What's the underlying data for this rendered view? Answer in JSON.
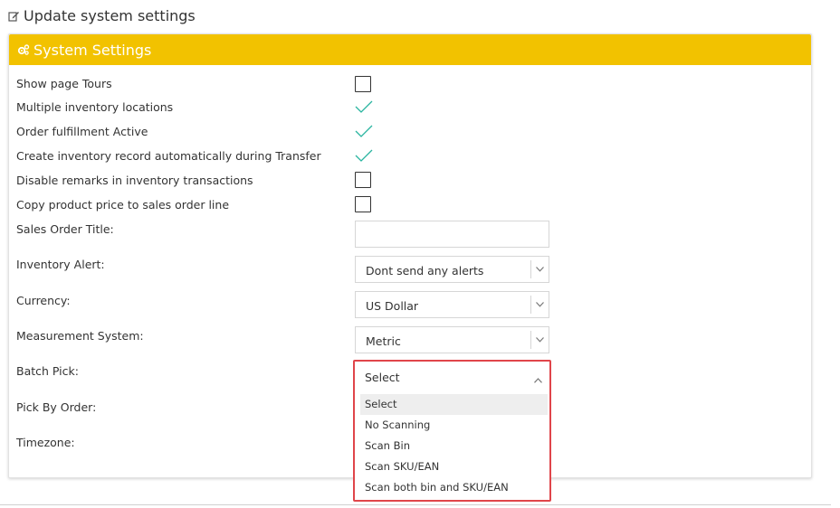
{
  "page": {
    "title": "Update system settings",
    "title_icon": "edit-icon"
  },
  "panel": {
    "title": "System Settings",
    "icon": "cogs-icon",
    "header_color": "#f2c200"
  },
  "checkbox_rows": [
    {
      "label": "Show page Tours",
      "checked": false
    },
    {
      "label": "Multiple inventory locations",
      "checked": true
    },
    {
      "label": "Order fulfillment Active",
      "checked": true
    },
    {
      "label": "Create inventory record automatically during Transfer",
      "checked": true
    },
    {
      "label": "Disable remarks in inventory transactions",
      "checked": false
    },
    {
      "label": "Copy product price to sales order line",
      "checked": false
    }
  ],
  "fields": {
    "sales_order_title": {
      "label": "Sales Order Title:",
      "value": ""
    },
    "inventory_alert": {
      "label": "Inventory Alert:",
      "value": "Dont send any alerts"
    },
    "currency": {
      "label": "Currency:",
      "value": "US Dollar"
    },
    "measurement_system": {
      "label": "Measurement System:",
      "value": "Metric"
    },
    "batch_pick": {
      "label": "Batch Pick:",
      "value": "Select",
      "options": [
        "Select",
        "No Scanning",
        "Scan Bin",
        "Scan SKU/EAN",
        "Scan both bin and SKU/EAN"
      ],
      "highlighted_option": "Select"
    },
    "pick_by_order": {
      "label": "Pick By Order:"
    },
    "timezone": {
      "label": "Timezone:"
    }
  },
  "colors": {
    "check": "#2ab5a0",
    "highlight_border": "#e0454a"
  }
}
